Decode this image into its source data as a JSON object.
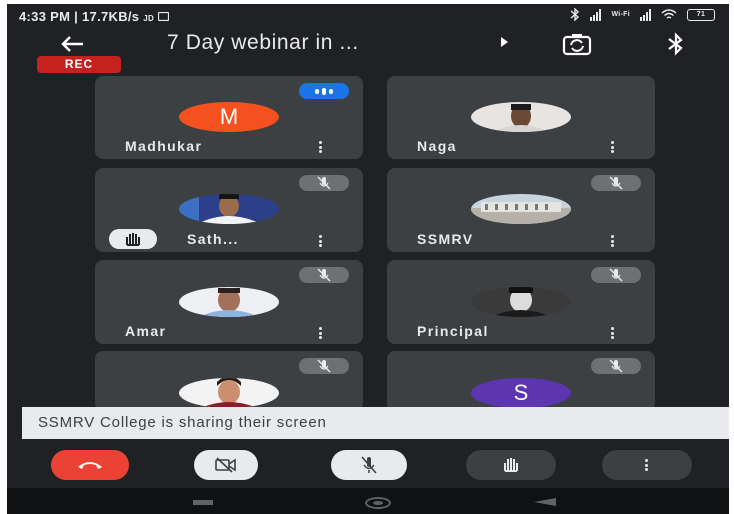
{
  "status_bar": {
    "time": "4:33 PM",
    "separator": "|",
    "speed": "17.7KB/s",
    "carrier_tag": "JD",
    "wifi_label": "Wi-Fi",
    "battery": "71"
  },
  "call": {
    "title": "7 Day webinar in ...",
    "rec_label": "REC"
  },
  "participants": [
    {
      "name": "Madhukar",
      "avatar_letter": "M",
      "avatar_color": "#f4511e",
      "speaking": true,
      "muted": false
    },
    {
      "name": "Naga",
      "speaking": false,
      "muted": false
    },
    {
      "name": "Sath...",
      "speaking": false,
      "muted": true,
      "hand_raised": true
    },
    {
      "name": "SSMRV",
      "speaking": false,
      "muted": true
    },
    {
      "name": "Amar",
      "speaking": false,
      "muted": true
    },
    {
      "name": "Principal",
      "speaking": false,
      "muted": true
    },
    {
      "name": "",
      "speaking": false,
      "muted": true
    },
    {
      "name": "",
      "avatar_letter": "S",
      "avatar_color": "#5e35b1",
      "speaking": false,
      "muted": true
    }
  ],
  "share_banner": "SSMRV College is sharing their screen",
  "colors": {
    "background": "#202124",
    "tile": "#3c4043",
    "end_call": "#ea4335",
    "rec": "#c5221f",
    "speaking": "#1a73e8"
  },
  "icons": [
    "back-arrow-icon",
    "camera-switch-icon",
    "bluetooth-icon",
    "mic-off-icon",
    "more-vert-icon",
    "raised-hand-icon",
    "call-end-icon",
    "videocam-off-icon"
  ]
}
